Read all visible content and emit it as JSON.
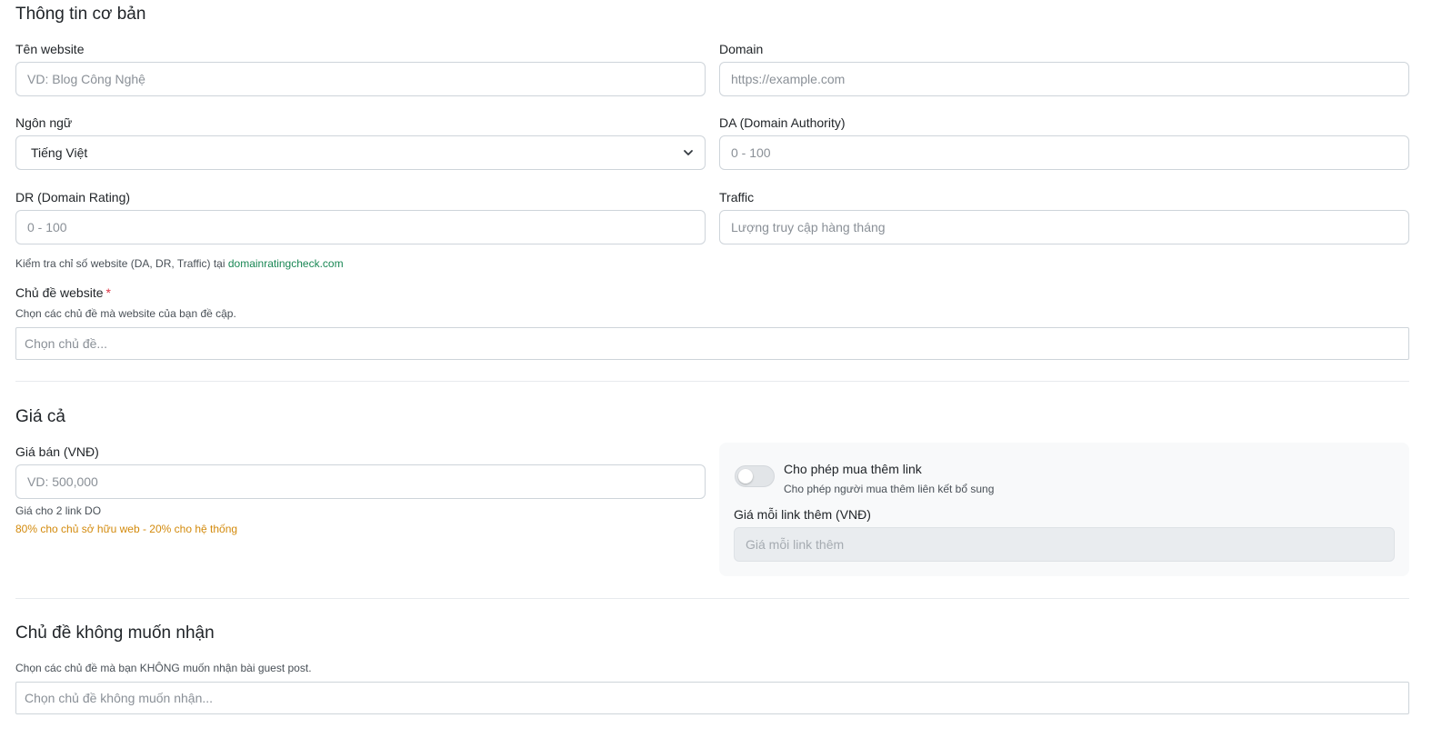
{
  "basic": {
    "title": "Thông tin cơ bản",
    "website_name": {
      "label": "Tên website",
      "placeholder": "VD: Blog Công Nghệ",
      "value": ""
    },
    "domain": {
      "label": "Domain",
      "placeholder": "https://example.com",
      "value": ""
    },
    "language": {
      "label": "Ngôn ngữ",
      "selected": "Tiếng Việt",
      "icon": "chevron-down-icon"
    },
    "da": {
      "label": "DA (Domain Authority)",
      "placeholder": "0 - 100",
      "value": ""
    },
    "dr": {
      "label": "DR (Domain Rating)",
      "placeholder": "0 - 100",
      "value": ""
    },
    "traffic": {
      "label": "Traffic",
      "placeholder": "Lượng truy cập hàng tháng",
      "value": ""
    },
    "check_note": "Kiểm tra chỉ số website (DA, DR, Traffic) tại",
    "check_link": "domainratingcheck.com",
    "topics": {
      "label": "Chủ đề website",
      "required_mark": "*",
      "help": "Chọn các chủ đề mà website của bạn đề cập.",
      "placeholder": "Chọn chủ đề..."
    }
  },
  "pricing": {
    "title": "Giá cả",
    "price": {
      "label": "Giá bán (VNĐ)",
      "placeholder": "VD: 500,000",
      "value": ""
    },
    "price_note": "Giá cho 2 link DO",
    "commission_note": "80% cho chủ sở hữu web - 20% cho hệ thống",
    "extra_links": {
      "toggle_label": "Cho phép mua thêm link",
      "toggle_help": "Cho phép người mua thêm liên kết bổ sung",
      "enabled": false,
      "price_label": "Giá mỗi link thêm (VNĐ)",
      "price_placeholder": "Giá mỗi link thêm"
    }
  },
  "excluded": {
    "title": "Chủ đề không muốn nhận",
    "help": "Chọn các chủ đề mà bạn KHÔNG muốn nhận bài guest post.",
    "placeholder": "Chọn chủ đề không muốn nhận..."
  },
  "colors": {
    "link": "#198754",
    "warning": "#d38a0c",
    "required": "#dc3545",
    "panel_bg": "#f8f9fa"
  }
}
